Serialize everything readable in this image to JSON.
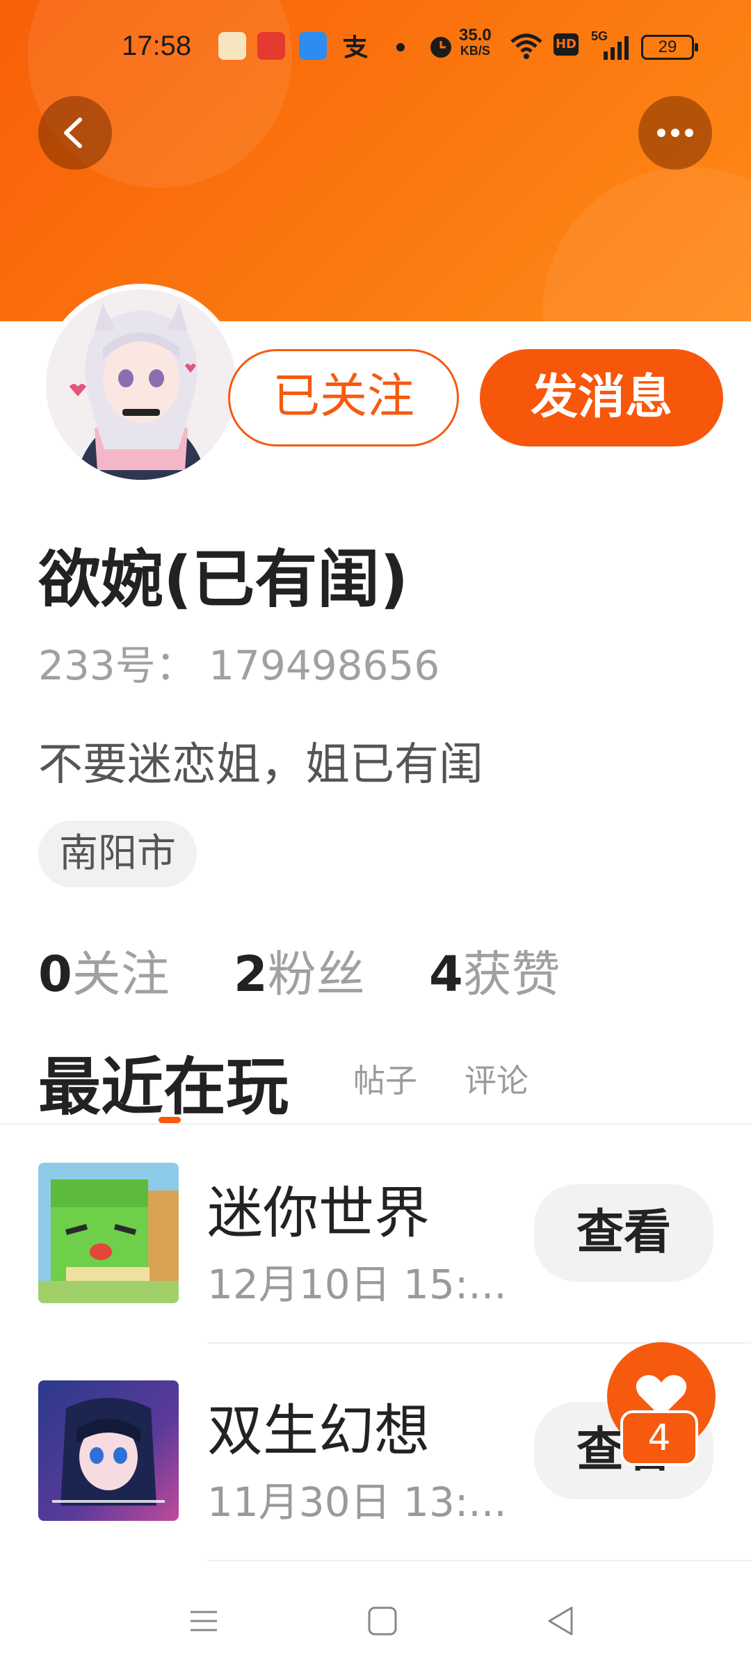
{
  "status_bar": {
    "time": "17:58",
    "net_speed_value": "35.0",
    "net_speed_unit": "KB/S",
    "hd_label": "HD",
    "signal_label": "5G",
    "battery": "29"
  },
  "profile": {
    "follow_label": "已关注",
    "message_label": "发消息",
    "name": "欲婉(已有闺)",
    "uid": "233号： 179498656",
    "bio": "不要迷恋姐，姐已有闺",
    "location": "南阳市",
    "stats": {
      "following_count": "0",
      "following_label": "关注",
      "fans_count": "2",
      "fans_label": "粉丝",
      "likes_count": "4",
      "likes_label": "获赞"
    }
  },
  "tabs": {
    "active": "最近在玩",
    "posts": "帖子",
    "comments": "评论"
  },
  "games": [
    {
      "name": "迷你世界",
      "time": "12月10日 15:...",
      "action": "查看"
    },
    {
      "name": "双生幻想",
      "time": "11月30日 13:...",
      "action": "查看"
    }
  ],
  "like_badge_count": "4",
  "colors": {
    "accent": "#f55a0f"
  }
}
